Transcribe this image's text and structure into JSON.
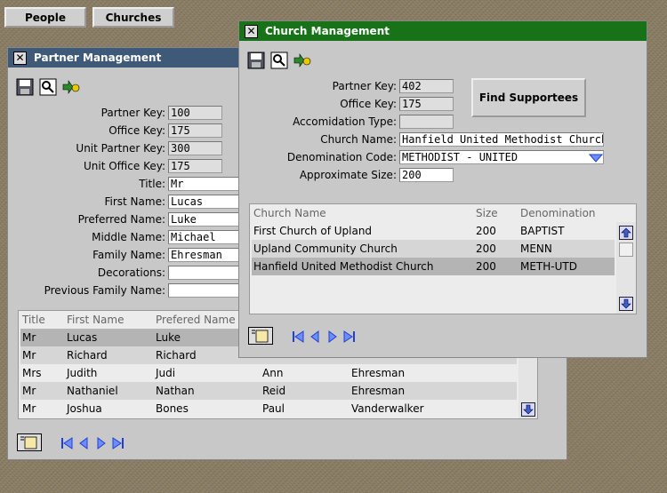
{
  "topbar": {
    "people_label": "People",
    "churches_label": "Churches"
  },
  "partner": {
    "title": "Partner Management",
    "fields": [
      {
        "label": "Partner Key:",
        "value": "100",
        "readonly": true
      },
      {
        "label": "Office Key:",
        "value": "175",
        "readonly": true
      },
      {
        "label": "Unit Partner Key:",
        "value": "300",
        "readonly": true
      },
      {
        "label": "Unit Office Key:",
        "value": "175",
        "readonly": true
      },
      {
        "label": "Title:",
        "value": "Mr",
        "readonly": false
      },
      {
        "label": "First Name:",
        "value": "Lucas",
        "readonly": false
      },
      {
        "label": "Preferred Name:",
        "value": "Luke",
        "readonly": false
      },
      {
        "label": "Middle Name:",
        "value": "Michael",
        "readonly": false
      },
      {
        "label": "Family Name:",
        "value": "Ehresman",
        "readonly": false
      },
      {
        "label": "Decorations:",
        "value": "",
        "readonly": false
      },
      {
        "label": "Previous Family Name:",
        "value": "",
        "readonly": false
      }
    ],
    "table": {
      "columns": [
        "Title",
        "First Name",
        "Prefered Name",
        "",
        ""
      ],
      "rows": [
        [
          "Mr",
          "Lucas",
          "Luke",
          "",
          ""
        ],
        [
          "Mr",
          "Richard",
          "Richard",
          "",
          ""
        ],
        [
          "Mrs",
          "Judith",
          "Judi",
          "Ann",
          "Ehresman"
        ],
        [
          "Mr",
          "Nathaniel",
          "Nathan",
          "Reid",
          "Ehresman"
        ],
        [
          "Mr",
          "Joshua",
          "Bones",
          "Paul",
          "Vanderwalker"
        ]
      ]
    }
  },
  "church": {
    "title": "Church Management",
    "find_label": "Find Supportees",
    "fields": [
      {
        "label": "Partner Key:",
        "value": "402",
        "readonly": true
      },
      {
        "label": "Office Key:",
        "value": "175",
        "readonly": true
      },
      {
        "label": "Accomidation Type:",
        "value": "",
        "readonly": true
      },
      {
        "label": "Church Name:",
        "value": "Hanfield United Methodist Church",
        "readonly": false
      },
      {
        "label": "Denomination Code:",
        "value": "METHODIST - UNITED",
        "readonly": false
      },
      {
        "label": "Approximate Size:",
        "value": "200",
        "readonly": false
      }
    ],
    "table": {
      "columns": [
        "Church Name",
        "Size",
        "Denomination"
      ],
      "rows": [
        [
          "First Church of Upland",
          "200",
          "BAPTIST"
        ],
        [
          "Upland Community Church",
          "200",
          "MENN"
        ],
        [
          "Hanfield United Methodist Church",
          "200",
          "METH-UTD"
        ]
      ]
    }
  },
  "colors": {
    "partner_title_bg": "#3e5a78",
    "church_title_bg": "#187318"
  }
}
